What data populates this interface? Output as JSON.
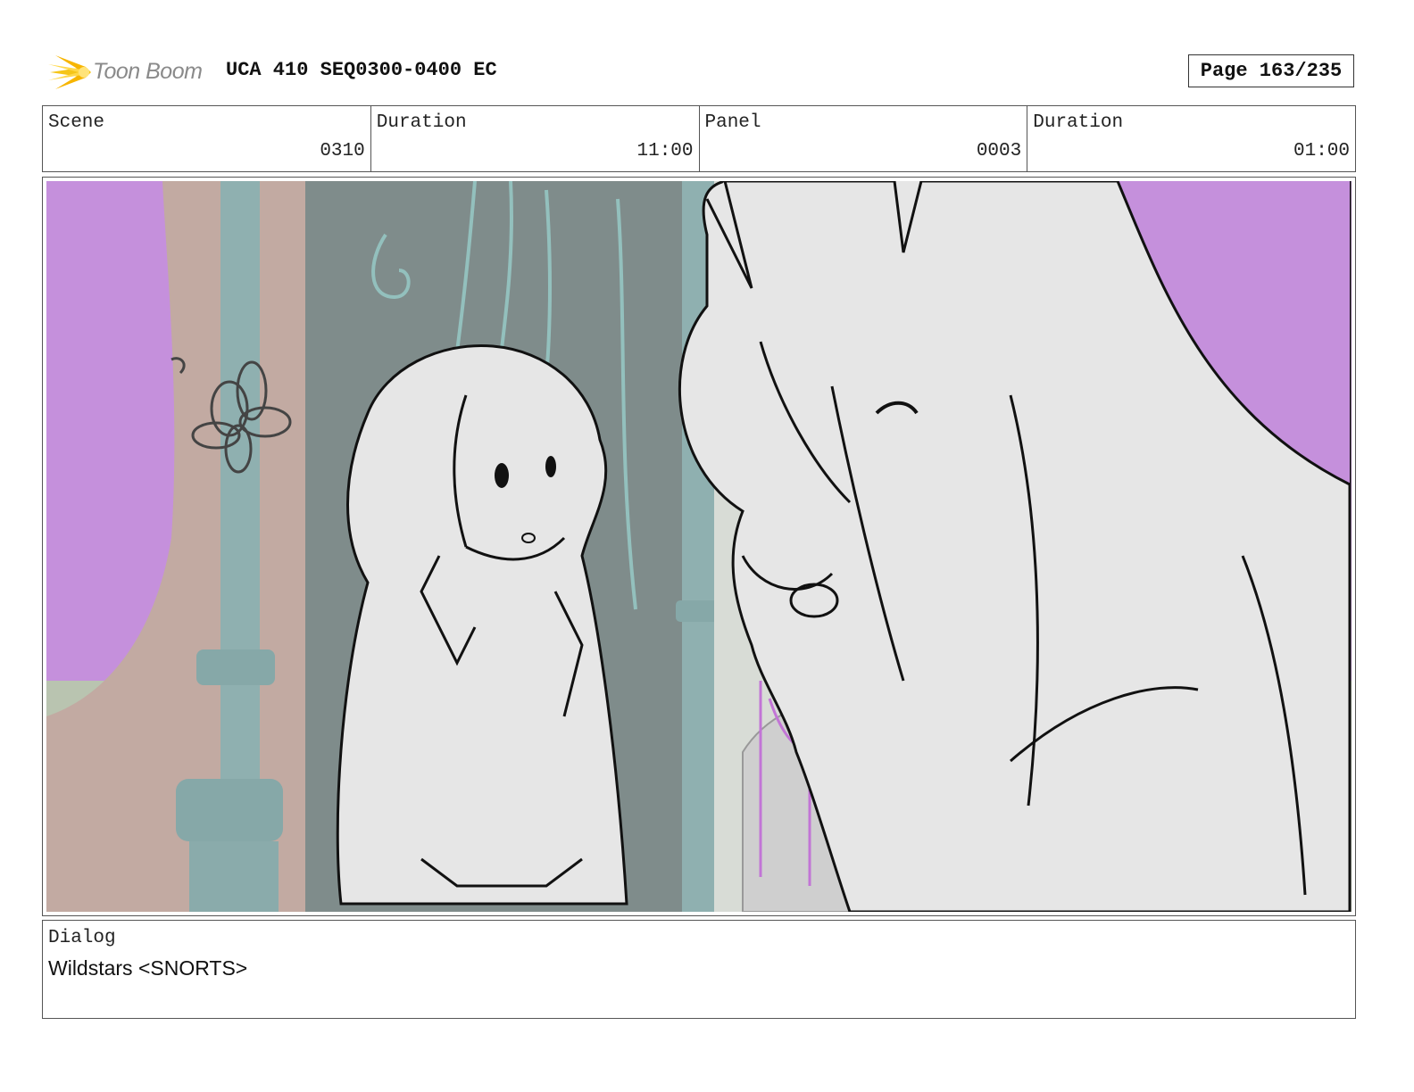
{
  "header": {
    "logo_text": "Toon Boom",
    "doc_title": "UCA 410 SEQ0300-0400 EC",
    "page_label": "Page 163/235"
  },
  "info": {
    "scene_label": "Scene",
    "scene_value": "0310",
    "scene_duration_label": "Duration",
    "scene_duration_value": "11:00",
    "panel_label": "Panel",
    "panel_value": "0003",
    "panel_duration_label": "Duration",
    "panel_duration_value": "01:00"
  },
  "dialog": {
    "label": "Dialog",
    "text": "Wildstars <SNORTS>"
  },
  "colors": {
    "logo_yellow": "#f5c518",
    "wall_purple": "#c590dc",
    "curtain_gray": "#7f8c8b",
    "pillar_teal": "#8fb0b0",
    "sketch_fill": "#e6e6e6"
  }
}
